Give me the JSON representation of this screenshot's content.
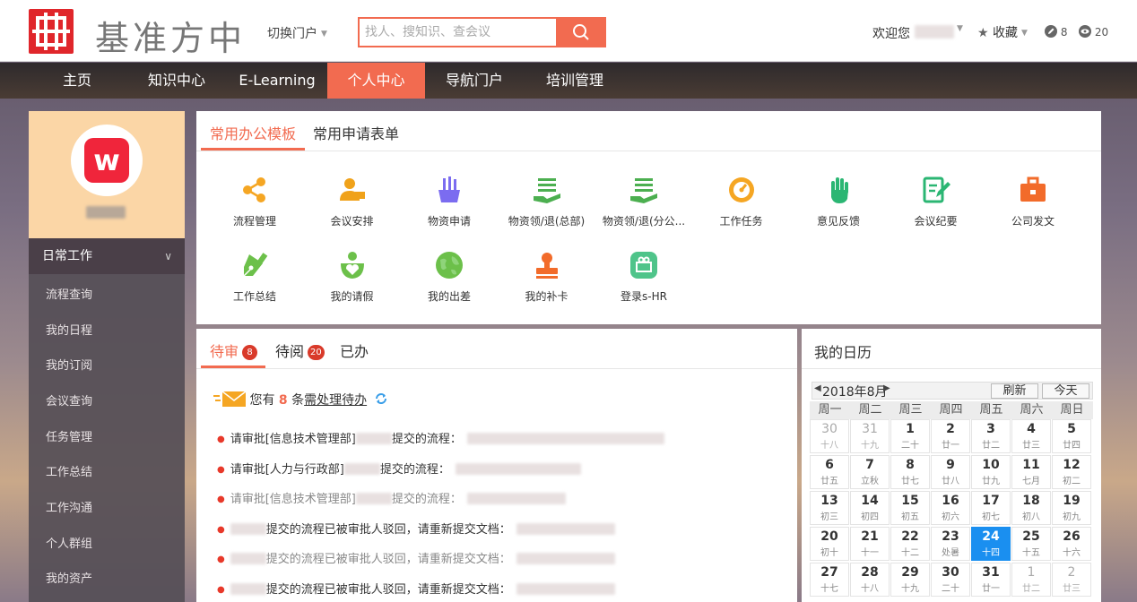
{
  "header": {
    "logo_text": "基准方中",
    "switch_label": "切换门户",
    "search_placeholder": "找人、搜知识、查会议",
    "welcome": "欢迎您",
    "fav_label": "收藏",
    "count_edit": "8",
    "count_view": "20"
  },
  "nav": [
    "主页",
    "知识中心",
    "E-Learning",
    "个人中心",
    "导航门户",
    "培训管理"
  ],
  "nav_active": "个人中心",
  "sidebar": {
    "section": "日常工作",
    "items": [
      "流程查询",
      "我的日程",
      "我的订阅",
      "会议查询",
      "任务管理",
      "工作总结",
      "工作沟通",
      "个人群组",
      "我的资产"
    ]
  },
  "templates": {
    "tabs": [
      "常用办公模板",
      "常用申请表单"
    ],
    "items": [
      {
        "label": "流程管理",
        "icon": "share-icon",
        "color": "#f5a623"
      },
      {
        "label": "会议安排",
        "icon": "meeting-person-icon",
        "color": "#f0a21a"
      },
      {
        "label": "物资申请",
        "icon": "supplies-icon",
        "color": "#7b6cf0"
      },
      {
        "label": "物资领/退(总部)",
        "icon": "receipt-hand-icon",
        "color": "#4caf50"
      },
      {
        "label": "物资领/退(分公...",
        "icon": "receipt-hand-icon",
        "color": "#4caf50"
      },
      {
        "label": "工作任务",
        "icon": "gauge-icon",
        "color": "#f5a623"
      },
      {
        "label": "意见反馈",
        "icon": "hand-icon",
        "color": "#2bb673"
      },
      {
        "label": "会议纪要",
        "icon": "edit-note-icon",
        "color": "#2bb673"
      },
      {
        "label": "公司发文",
        "icon": "briefcase-icon",
        "color": "#f26b2a"
      },
      {
        "label": "工作总结",
        "icon": "pen-nib-icon",
        "color": "#6cc04a"
      },
      {
        "label": "我的请假",
        "icon": "heart-person-icon",
        "color": "#6cc04a"
      },
      {
        "label": "我的出差",
        "icon": "globe-icon",
        "color": "#6cc04a"
      },
      {
        "label": "我的补卡",
        "icon": "stamp-icon",
        "color": "#f26b2a"
      },
      {
        "label": "登录s-HR",
        "icon": "hr-icon",
        "color": "#4fc48a"
      }
    ]
  },
  "tasks": {
    "tabs": [
      {
        "label": "待审",
        "badge": "8"
      },
      {
        "label": "待阅",
        "badge": "20"
      },
      {
        "label": "已办",
        "badge": ""
      }
    ],
    "notice_pre": "您有",
    "notice_num": "8",
    "notice_mid": "条",
    "notice_link": "需处理待办",
    "rows": [
      {
        "a": "请审批[信息技术管理部]",
        "b": "提交的流程：",
        "dim": false
      },
      {
        "a": "请审批[人力与行政部]",
        "b": "提交的流程：",
        "dim": false
      },
      {
        "a": "请审批[信息技术管理部]",
        "b": "提交的流程：",
        "dim": true
      },
      {
        "a": "",
        "b": "提交的流程已被审批人驳回，请重新提交文档：",
        "dim": false
      },
      {
        "a": "",
        "b": "提交的流程已被审批人驳回，请重新提交文档：",
        "dim": true
      },
      {
        "a": "",
        "b": "提交的流程已被审批人驳回，请重新提交文档：",
        "dim": false
      }
    ]
  },
  "calendar": {
    "title": "我的日历",
    "month": "2018年8月",
    "refresh": "刷新",
    "today_btn": "今天",
    "weekdays": [
      "周一",
      "周二",
      "周三",
      "周四",
      "周五",
      "周六",
      "周日"
    ],
    "days": [
      {
        "d": "30",
        "l": "十八",
        "o": true
      },
      {
        "d": "31",
        "l": "十九",
        "o": true
      },
      {
        "d": "1",
        "l": "二十"
      },
      {
        "d": "2",
        "l": "廿一"
      },
      {
        "d": "3",
        "l": "廿二"
      },
      {
        "d": "4",
        "l": "廿三"
      },
      {
        "d": "5",
        "l": "廿四"
      },
      {
        "d": "6",
        "l": "廿五"
      },
      {
        "d": "7",
        "l": "立秋"
      },
      {
        "d": "8",
        "l": "廿七"
      },
      {
        "d": "9",
        "l": "廿八"
      },
      {
        "d": "10",
        "l": "廿九"
      },
      {
        "d": "11",
        "l": "七月"
      },
      {
        "d": "12",
        "l": "初二"
      },
      {
        "d": "13",
        "l": "初三"
      },
      {
        "d": "14",
        "l": "初四"
      },
      {
        "d": "15",
        "l": "初五"
      },
      {
        "d": "16",
        "l": "初六"
      },
      {
        "d": "17",
        "l": "初七"
      },
      {
        "d": "18",
        "l": "初八"
      },
      {
        "d": "19",
        "l": "初九"
      },
      {
        "d": "20",
        "l": "初十"
      },
      {
        "d": "21",
        "l": "十一"
      },
      {
        "d": "22",
        "l": "十二"
      },
      {
        "d": "23",
        "l": "处暑"
      },
      {
        "d": "24",
        "l": "十四",
        "t": true
      },
      {
        "d": "25",
        "l": "十五"
      },
      {
        "d": "26",
        "l": "十六"
      },
      {
        "d": "27",
        "l": "十七"
      },
      {
        "d": "28",
        "l": "十八"
      },
      {
        "d": "29",
        "l": "十九"
      },
      {
        "d": "30",
        "l": "二十"
      },
      {
        "d": "31",
        "l": "廿一"
      },
      {
        "d": "1",
        "l": "廿二",
        "o": true
      },
      {
        "d": "2",
        "l": "廿三",
        "o": true
      }
    ]
  }
}
